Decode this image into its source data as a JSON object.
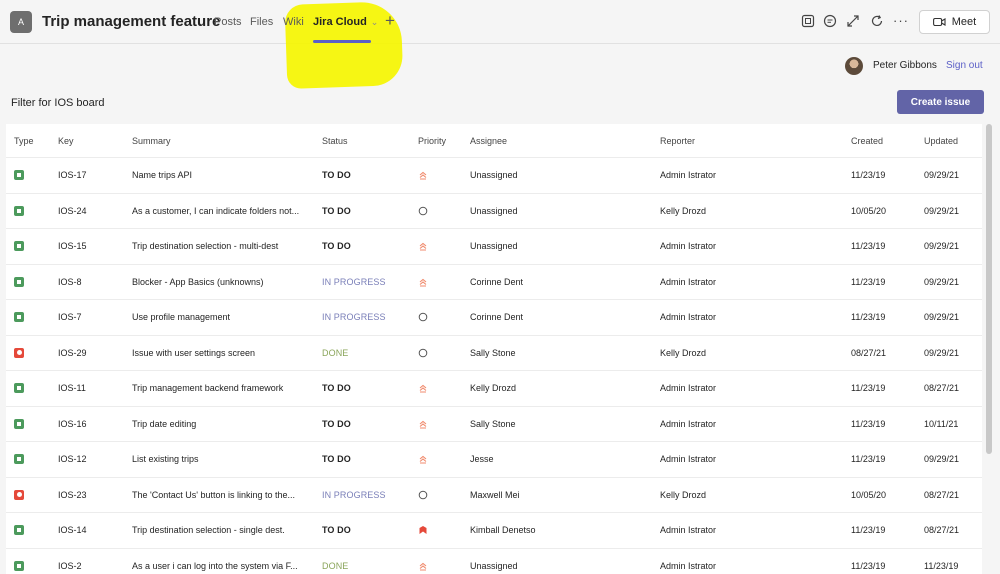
{
  "header": {
    "team_initial": "A",
    "channel_title": "Trip management feature",
    "tabs": [
      {
        "label": "Posts"
      },
      {
        "label": "Files"
      },
      {
        "label": "Wiki"
      },
      {
        "label": "Jira Cloud",
        "active": true
      }
    ],
    "add_tab_glyph": "+",
    "icons": [
      "team-notes-icon",
      "chat-icon",
      "expand-icon",
      "refresh-icon",
      "more-options-icon"
    ],
    "more_glyph": "···",
    "meet_label": "Meet"
  },
  "user": {
    "name": "Peter Gibbons",
    "sign_out_label": "Sign out"
  },
  "filter_label": "Filter for IOS board",
  "create_issue_label": "Create issue",
  "colors": {
    "accent": "#5b5fc7",
    "create_button": "#6264a7",
    "story": "#4c9a5c",
    "bug": "#e5493a",
    "highlight": "#f5f500"
  },
  "table": {
    "columns": [
      "Type",
      "Key",
      "Summary",
      "Status",
      "Priority",
      "Assignee",
      "Reporter",
      "Created",
      "Updated"
    ],
    "rows": [
      {
        "type": "story",
        "key": "IOS-17",
        "summary": "Name trips API",
        "status": "TO DO",
        "priority": "medium",
        "assignee": "Unassigned",
        "reporter": "Admin Istrator",
        "created": "11/23/19",
        "updated": "09/29/21"
      },
      {
        "type": "story",
        "key": "IOS-24",
        "summary": "As a customer, I can indicate folders not...",
        "status": "TO DO",
        "priority": "none",
        "assignee": "Unassigned",
        "reporter": "Kelly Drozd",
        "created": "10/05/20",
        "updated": "09/29/21"
      },
      {
        "type": "story",
        "key": "IOS-15",
        "summary": "Trip destination selection - multi-dest",
        "status": "TO DO",
        "priority": "medium",
        "assignee": "Unassigned",
        "reporter": "Admin Istrator",
        "created": "11/23/19",
        "updated": "09/29/21"
      },
      {
        "type": "story",
        "key": "IOS-8",
        "summary": "Blocker - App Basics (unknowns)",
        "status": "IN PROGRESS",
        "priority": "medium",
        "assignee": "Corinne Dent",
        "reporter": "Admin Istrator",
        "created": "11/23/19",
        "updated": "09/29/21"
      },
      {
        "type": "story",
        "key": "IOS-7",
        "summary": "Use profile management",
        "status": "IN PROGRESS",
        "priority": "none",
        "assignee": "Corinne Dent",
        "reporter": "Admin Istrator",
        "created": "11/23/19",
        "updated": "09/29/21"
      },
      {
        "type": "bug",
        "key": "IOS-29",
        "summary": "Issue with user settings screen",
        "status": "DONE",
        "priority": "none",
        "assignee": "Sally Stone",
        "reporter": "Kelly Drozd",
        "created": "08/27/21",
        "updated": "09/29/21"
      },
      {
        "type": "story",
        "key": "IOS-11",
        "summary": "Trip management backend framework",
        "status": "TO DO",
        "priority": "medium",
        "assignee": "Kelly Drozd",
        "reporter": "Admin Istrator",
        "created": "11/23/19",
        "updated": "08/27/21"
      },
      {
        "type": "story",
        "key": "IOS-16",
        "summary": "Trip date editing",
        "status": "TO DO",
        "priority": "medium",
        "assignee": "Sally Stone",
        "reporter": "Admin Istrator",
        "created": "11/23/19",
        "updated": "10/11/21"
      },
      {
        "type": "story",
        "key": "IOS-12",
        "summary": "List existing trips",
        "status": "TO DO",
        "priority": "medium",
        "assignee": "Jesse",
        "reporter": "Admin Istrator",
        "created": "11/23/19",
        "updated": "09/29/21"
      },
      {
        "type": "bug",
        "key": "IOS-23",
        "summary": "The 'Contact Us' button is linking to the...",
        "status": "IN PROGRESS",
        "priority": "none",
        "assignee": "Maxwell Mei",
        "reporter": "Kelly Drozd",
        "created": "10/05/20",
        "updated": "08/27/21"
      },
      {
        "type": "story",
        "key": "IOS-14",
        "summary": "Trip destination selection - single dest.",
        "status": "TO DO",
        "priority": "highest",
        "assignee": "Kimball Denetso",
        "reporter": "Admin Istrator",
        "created": "11/23/19",
        "updated": "08/27/21"
      },
      {
        "type": "story",
        "key": "IOS-2",
        "summary": "As a user i can log into the system via F...",
        "status": "DONE",
        "priority": "medium",
        "assignee": "Unassigned",
        "reporter": "Admin Istrator",
        "created": "11/23/19",
        "updated": "11/23/19"
      }
    ]
  }
}
